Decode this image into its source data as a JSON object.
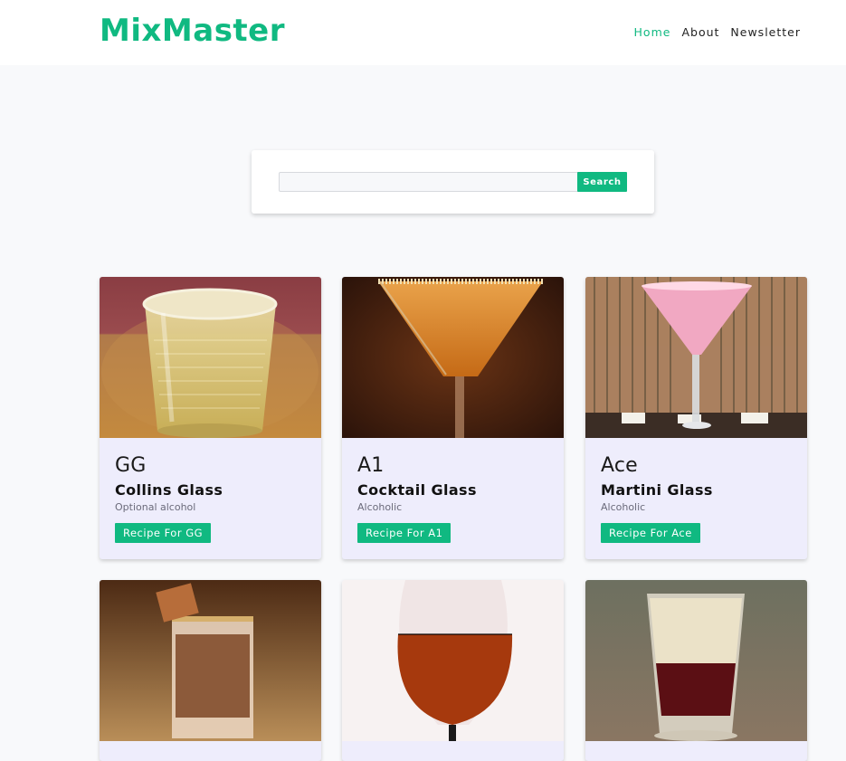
{
  "header": {
    "logo": "MixMaster",
    "nav": [
      {
        "label": "Home",
        "active": true
      },
      {
        "label": "About",
        "active": false
      },
      {
        "label": "Newsletter",
        "active": false
      }
    ]
  },
  "search": {
    "value": "",
    "placeholder": "",
    "button_label": "Search"
  },
  "cocktails": [
    {
      "name": "GG",
      "glass": "Collins Glass",
      "alcohol": "Optional alcohol",
      "button": "Recipe For GG",
      "image": "collins-glass-drink"
    },
    {
      "name": "A1",
      "glass": "Cocktail Glass",
      "alcohol": "Alcoholic",
      "button": "Recipe For A1",
      "image": "orange-martini-drink"
    },
    {
      "name": "Ace",
      "glass": "Martini Glass",
      "alcohol": "Alcoholic",
      "button": "Recipe For Ace",
      "image": "pink-martini-drink"
    },
    {
      "image": "shot-glass-caramel-drink"
    },
    {
      "image": "wine-glass-amber-drink"
    },
    {
      "image": "layered-shot-drink"
    }
  ],
  "colors": {
    "brand": "#10b981",
    "background": "#f8f9fb",
    "card_background": "#eeedfc"
  }
}
